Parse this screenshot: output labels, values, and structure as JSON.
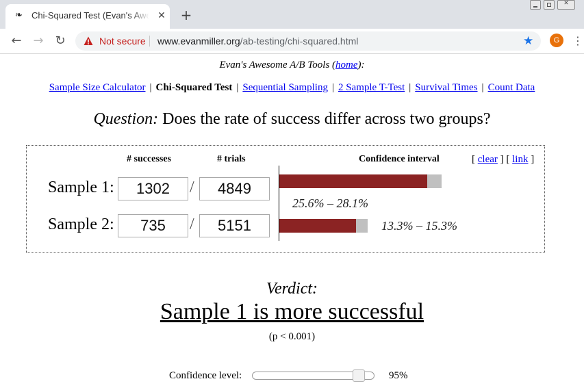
{
  "browser": {
    "tab_title": "Chi-Squared Test (Evan's Awesome A/B Tools)",
    "tab_favicon": "bug-icon",
    "close_glyph": "✕",
    "newtab_glyph": "+",
    "nav": {
      "back": "←",
      "forward": "→",
      "reload": "↻"
    },
    "security_label": "Not secure",
    "url_host": "www.evanmiller.org",
    "url_path": "/ab-testing/chi-squared.html",
    "star_glyph": "★",
    "profile_initial": "G",
    "menu_glyph": "⋮"
  },
  "header": {
    "prefix": "Evan's Awesome A/B Tools (",
    "home_link": "home",
    "suffix": "):"
  },
  "toolnav": {
    "items": [
      "Sample Size Calculator",
      "Chi-Squared Test",
      "Sequential Sampling",
      "2 Sample T-Test",
      "Survival Times",
      "Count Data"
    ],
    "current": "Chi-Squared Test",
    "separator": "|"
  },
  "question": {
    "label": "Question:",
    "text": " Does the rate of success differ across two groups?"
  },
  "table": {
    "col_successes": "# successes",
    "col_trials": "# trials",
    "col_ci": "Confidence interval",
    "clear_link": "clear",
    "link_link": "link",
    "slash": "/",
    "samples": [
      {
        "label": "Sample 1:",
        "successes": "1302",
        "trials": "4849",
        "ci_text": "25.6% – 28.1%",
        "ci_low": 0.256,
        "ci_high": 0.281
      },
      {
        "label": "Sample 2:",
        "successes": "735",
        "trials": "5151",
        "ci_text": "13.3% – 15.3%",
        "ci_low": 0.133,
        "ci_high": 0.153
      }
    ]
  },
  "verdict": {
    "label": "Verdict:",
    "text": "Sample 1 is more successful",
    "p_value": "(p < 0.001)"
  },
  "confidence": {
    "label": "Confidence level:",
    "value_text": "95%",
    "level": 0.95
  },
  "colors": {
    "bar_fill": "#8b2323",
    "bar_ci": "#c0c0c0",
    "link": "#0000ee",
    "warning": "#c5221f",
    "star": "#1a73e8",
    "profile": "#e8710a"
  }
}
